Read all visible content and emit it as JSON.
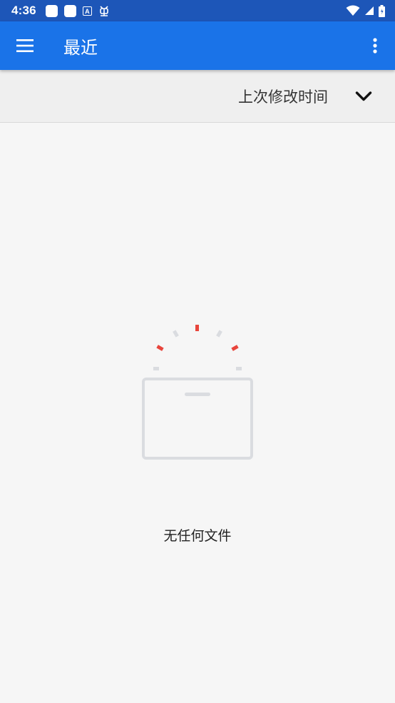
{
  "status_bar": {
    "time": "4:36",
    "notification_icons": [
      "app-icon",
      "app-icon",
      "a-icon",
      "bug-icon"
    ],
    "system_icons": [
      "wifi-icon",
      "signal-icon",
      "battery-icon"
    ]
  },
  "app_bar": {
    "title": "最近",
    "menu_icon": "menu-icon",
    "overflow_icon": "more-vert-icon",
    "background_color": "#1a73e8"
  },
  "sort_bar": {
    "label": "上次修改时间",
    "icon": "chevron-down-icon"
  },
  "empty_state": {
    "message": "无任何文件",
    "illustration": "empty-folder-illustration"
  },
  "colors": {
    "status_bar": "#1d56b8",
    "accent": "#1a73e8",
    "illustration_red": "#e8453c",
    "illustration_gray": "#dadce0"
  }
}
